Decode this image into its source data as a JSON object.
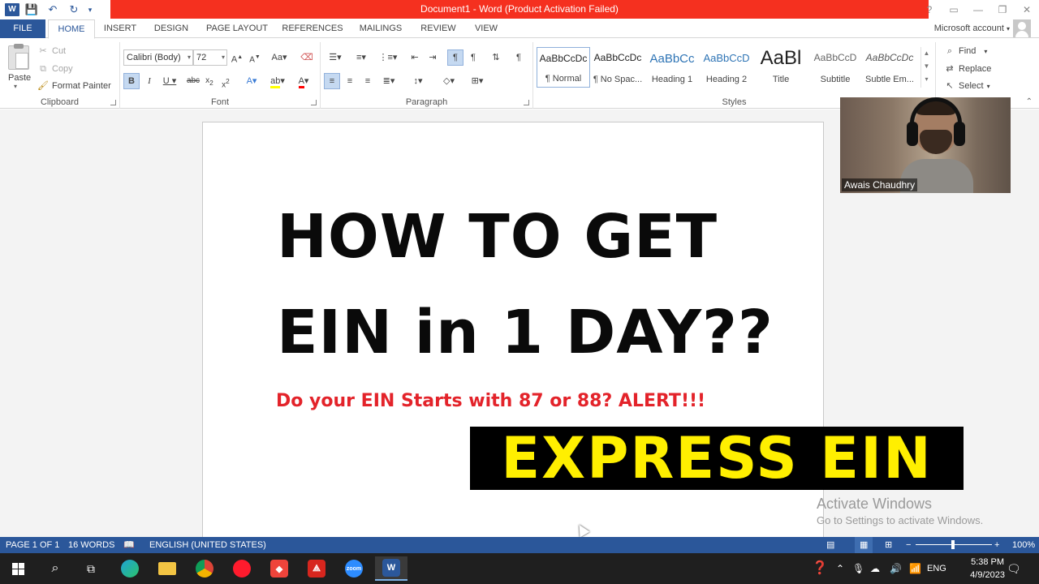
{
  "window": {
    "title": "Document1 - Word (Product Activation Failed)",
    "app_icon": "W",
    "controls": [
      "?",
      "▭",
      "—",
      "❐",
      "✕"
    ]
  },
  "tabs": {
    "file": "FILE",
    "items": [
      "HOME",
      "INSERT",
      "DESIGN",
      "PAGE LAYOUT",
      "REFERENCES",
      "MAILINGS",
      "REVIEW",
      "VIEW"
    ],
    "active": "HOME",
    "account": "Microsoft account"
  },
  "clipboard": {
    "paste": "Paste",
    "cut": "Cut",
    "copy": "Copy",
    "format_painter": "Format Painter",
    "label": "Clipboard"
  },
  "font": {
    "family": "Calibri (Body)",
    "size": "72",
    "label": "Font"
  },
  "paragraph": {
    "label": "Paragraph"
  },
  "styles": {
    "label": "Styles",
    "items": [
      {
        "preview": "AaBbCcDc",
        "name": "¶ Normal"
      },
      {
        "preview": "AaBbCcDc",
        "name": "¶ No Spac..."
      },
      {
        "preview": "AaBbCc",
        "name": "Heading 1"
      },
      {
        "preview": "AaBbCcD",
        "name": "Heading 2"
      },
      {
        "preview": "AaBl",
        "name": "Title"
      },
      {
        "preview": "AaBbCcD",
        "name": "Subtitle"
      },
      {
        "preview": "AaBbCcDc",
        "name": "Subtle Em..."
      }
    ]
  },
  "editing": {
    "find": "Find",
    "replace": "Replace",
    "select": "Select"
  },
  "document": {
    "line1": "HOW TO GET",
    "line2": "EIN in 1 DAY??",
    "subtitle": "Do your EIN Starts with 87 or 88? ALERT!!!"
  },
  "webcam": {
    "name": "Awais Chaudhry"
  },
  "overlay": {
    "text": "EXPRESS EIN"
  },
  "watermark": {
    "title": "Activate Windows",
    "subtitle": "Go to Settings to activate Windows."
  },
  "statusbar": {
    "page": "PAGE 1 OF 1",
    "words": "16 WORDS",
    "language": "ENGLISH (UNITED STATES)",
    "zoom": "100%"
  },
  "taskbar": {
    "lang": "ENG",
    "time": "5:38 PM",
    "date": "4/9/2023"
  },
  "colors": {
    "word_blue": "#2b579a",
    "title_red": "#f5301f",
    "alert_red": "#e3232a",
    "overlay_yellow": "#ffef00"
  }
}
